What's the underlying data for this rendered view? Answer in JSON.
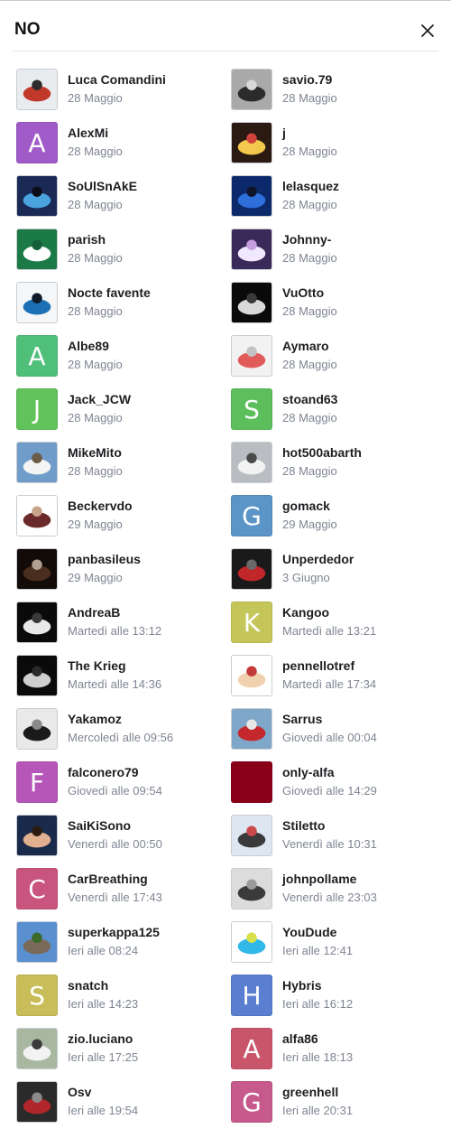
{
  "dialog": {
    "title": "NO",
    "close_icon": "close-icon"
  },
  "people": [
    {
      "name": "Luca Comandini",
      "time": "28 Maggio",
      "avatar": {
        "type": "photo",
        "scene": "motorbike",
        "colors": [
          "#e9ecef",
          "#c0392b",
          "#2c2c2c"
        ]
      }
    },
    {
      "name": "savio.79",
      "time": "28 Maggio",
      "avatar": {
        "type": "photo",
        "scene": "grey-abstract",
        "colors": [
          "#a9a9a9",
          "#2b2b2b",
          "#d9d9d9"
        ]
      }
    },
    {
      "name": "AlexMi",
      "time": "28 Maggio",
      "avatar": {
        "type": "letter",
        "letter": "A",
        "color": "#a05bc8"
      }
    },
    {
      "name": "j",
      "time": "28 Maggio",
      "avatar": {
        "type": "photo",
        "scene": "cartoon",
        "colors": [
          "#2a1a12",
          "#f2c94c",
          "#d0443c"
        ]
      }
    },
    {
      "name": "SoUlSnAkE",
      "time": "28 Maggio",
      "avatar": {
        "type": "photo",
        "scene": "blue-car",
        "colors": [
          "#1a2a55",
          "#4aa3df",
          "#0e0e1a"
        ]
      }
    },
    {
      "name": "lelasquez",
      "time": "28 Maggio",
      "avatar": {
        "type": "photo",
        "scene": "blue-car",
        "colors": [
          "#0c2a6b",
          "#2f6fdc",
          "#10162a"
        ]
      }
    },
    {
      "name": "parish",
      "time": "28 Maggio",
      "avatar": {
        "type": "photo",
        "scene": "jersey",
        "colors": [
          "#1b7a45",
          "#ffffff",
          "#14603a"
        ]
      }
    },
    {
      "name": "Johnny-",
      "time": "28 Maggio",
      "avatar": {
        "type": "photo",
        "scene": "axolotl",
        "colors": [
          "#3a2a5a",
          "#f0e8ff",
          "#c59fe0"
        ]
      }
    },
    {
      "name": "Nocte favente",
      "time": "28 Maggio",
      "avatar": {
        "type": "photo",
        "scene": "moon",
        "colors": [
          "#f4f6f8",
          "#1a6fb5",
          "#0d1b2a"
        ]
      }
    },
    {
      "name": "VuOtto",
      "time": "28 Maggio",
      "avatar": {
        "type": "photo",
        "scene": "dark-logo",
        "colors": [
          "#0a0a0a",
          "#d9d9d9",
          "#3a3a3a"
        ]
      }
    },
    {
      "name": "Albe89",
      "time": "28 Maggio",
      "avatar": {
        "type": "letter",
        "letter": "A",
        "color": "#4fbf7a"
      }
    },
    {
      "name": "Aymaro",
      "time": "28 Maggio",
      "avatar": {
        "type": "photo",
        "scene": "placeholder",
        "colors": [
          "#f2f2f2",
          "#e15b5b",
          "#c4c4c4"
        ]
      }
    },
    {
      "name": "Jack_JCW",
      "time": "28 Maggio",
      "avatar": {
        "type": "letter",
        "letter": "J",
        "color": "#62c25c"
      }
    },
    {
      "name": "stoand63",
      "time": "28 Maggio",
      "avatar": {
        "type": "letter",
        "letter": "S",
        "color": "#5cbf5c"
      }
    },
    {
      "name": "MikeMito",
      "time": "28 Maggio",
      "avatar": {
        "type": "photo",
        "scene": "white-car",
        "colors": [
          "#6f9cc8",
          "#f4f4f4",
          "#6b5a45"
        ]
      }
    },
    {
      "name": "hot500abarth",
      "time": "28 Maggio",
      "avatar": {
        "type": "photo",
        "scene": "white-car",
        "colors": [
          "#b9bcc0",
          "#f2f2f2",
          "#4a4a4a"
        ]
      }
    },
    {
      "name": "Beckervdo",
      "time": "29 Maggio",
      "avatar": {
        "type": "photo",
        "scene": "person",
        "colors": [
          "#ffffff",
          "#6a2a2a",
          "#c9a48a"
        ]
      }
    },
    {
      "name": "gomack",
      "time": "29 Maggio",
      "avatar": {
        "type": "letter",
        "letter": "G",
        "color": "#5b94c7"
      }
    },
    {
      "name": "panbasileus",
      "time": "29 Maggio",
      "avatar": {
        "type": "photo",
        "scene": "night-car",
        "colors": [
          "#120b08",
          "#4a2e1e",
          "#b0a090"
        ]
      }
    },
    {
      "name": "Unperdedor",
      "time": "3 Giugno",
      "avatar": {
        "type": "photo",
        "scene": "red-car",
        "colors": [
          "#1a1a1a",
          "#c0262a",
          "#6a6a6a"
        ]
      }
    },
    {
      "name": "AndreaB",
      "time": "Martedì alle 13:12",
      "avatar": {
        "type": "photo",
        "scene": "horse-logo",
        "colors": [
          "#0a0a0a",
          "#e8e8e8",
          "#3a3a3a"
        ]
      }
    },
    {
      "name": "Kangoo",
      "time": "Martedì alle 13:21",
      "avatar": {
        "type": "letter",
        "letter": "K",
        "color": "#c4c65a"
      }
    },
    {
      "name": "The Krieg",
      "time": "Martedì alle 14:36",
      "avatar": {
        "type": "photo",
        "scene": "grille-logo",
        "colors": [
          "#0a0a0a",
          "#cfcfcf",
          "#2a2a2a"
        ]
      }
    },
    {
      "name": "pennellotref",
      "time": "Martedì alle 17:34",
      "avatar": {
        "type": "photo",
        "scene": "cartoon-face",
        "colors": [
          "#ffffff",
          "#f1d2b0",
          "#c23a3a"
        ]
      }
    },
    {
      "name": "Yakamoz",
      "time": "Mercoledì alle 09:56",
      "avatar": {
        "type": "photo",
        "scene": "magazine",
        "colors": [
          "#e9e9e9",
          "#1a1a1a",
          "#8a8a8a"
        ]
      }
    },
    {
      "name": "Sarrus",
      "time": "Giovedì alle 00:04",
      "avatar": {
        "type": "photo",
        "scene": "red-car",
        "colors": [
          "#7fa7c9",
          "#c4282c",
          "#e6e6e6"
        ]
      }
    },
    {
      "name": "falconero79",
      "time": "Giovedì alle 09:54",
      "avatar": {
        "type": "letter",
        "letter": "F",
        "color": "#b656b8"
      }
    },
    {
      "name": "only-alfa",
      "time": "Giovedì alle 14:29",
      "avatar": {
        "type": "solid",
        "color": "#8a0019"
      }
    },
    {
      "name": "SaiKiSono",
      "time": "Venerdì alle 00:50",
      "avatar": {
        "type": "photo",
        "scene": "face",
        "colors": [
          "#1a2a4a",
          "#e0b090",
          "#2a1a10"
        ]
      }
    },
    {
      "name": "Stiletto",
      "time": "Venerdì alle 10:31",
      "avatar": {
        "type": "photo",
        "scene": "cartoon",
        "colors": [
          "#dde7f2",
          "#3a3a3a",
          "#c9484a"
        ]
      }
    },
    {
      "name": "CarBreathing",
      "time": "Venerdì alle 17:43",
      "avatar": {
        "type": "letter",
        "letter": "C",
        "color": "#c9557f"
      }
    },
    {
      "name": "johnpollame",
      "time": "Venerdì alle 23:03",
      "avatar": {
        "type": "photo",
        "scene": "bw-portrait",
        "colors": [
          "#dcdcdc",
          "#3a3a3a",
          "#9a9a9a"
        ]
      }
    },
    {
      "name": "superkappa125",
      "time": "Ieri alle 08:24",
      "avatar": {
        "type": "photo",
        "scene": "mountains",
        "colors": [
          "#5a8fd0",
          "#7a6a5a",
          "#3a6a2a"
        ]
      }
    },
    {
      "name": "YouDude",
      "time": "Ieri alle 12:41",
      "avatar": {
        "type": "photo",
        "scene": "badge",
        "colors": [
          "#ffffff",
          "#30b8e8",
          "#d8e04a"
        ]
      }
    },
    {
      "name": "snatch",
      "time": "Ieri alle 14:23",
      "avatar": {
        "type": "letter",
        "letter": "S",
        "color": "#c9bd5a"
      }
    },
    {
      "name": "Hybris",
      "time": "Ieri alle 16:12",
      "avatar": {
        "type": "letter",
        "letter": "H",
        "color": "#5b7fd0"
      }
    },
    {
      "name": "zio.luciano",
      "time": "Ieri alle 17:25",
      "avatar": {
        "type": "photo",
        "scene": "white-car",
        "colors": [
          "#a8b8a0",
          "#f2f2f2",
          "#3a3a3a"
        ]
      }
    },
    {
      "name": "alfa86",
      "time": "Ieri alle 18:13",
      "avatar": {
        "type": "letter",
        "letter": "A",
        "color": "#c9556b"
      }
    },
    {
      "name": "Osv",
      "time": "Ieri alle 19:54",
      "avatar": {
        "type": "photo",
        "scene": "engine",
        "colors": [
          "#2a2a2a",
          "#b0262a",
          "#8a8a8a"
        ]
      }
    },
    {
      "name": "greenhell",
      "time": "Ieri alle 20:31",
      "avatar": {
        "type": "letter",
        "letter": "G",
        "color": "#c65a8d"
      }
    }
  ]
}
